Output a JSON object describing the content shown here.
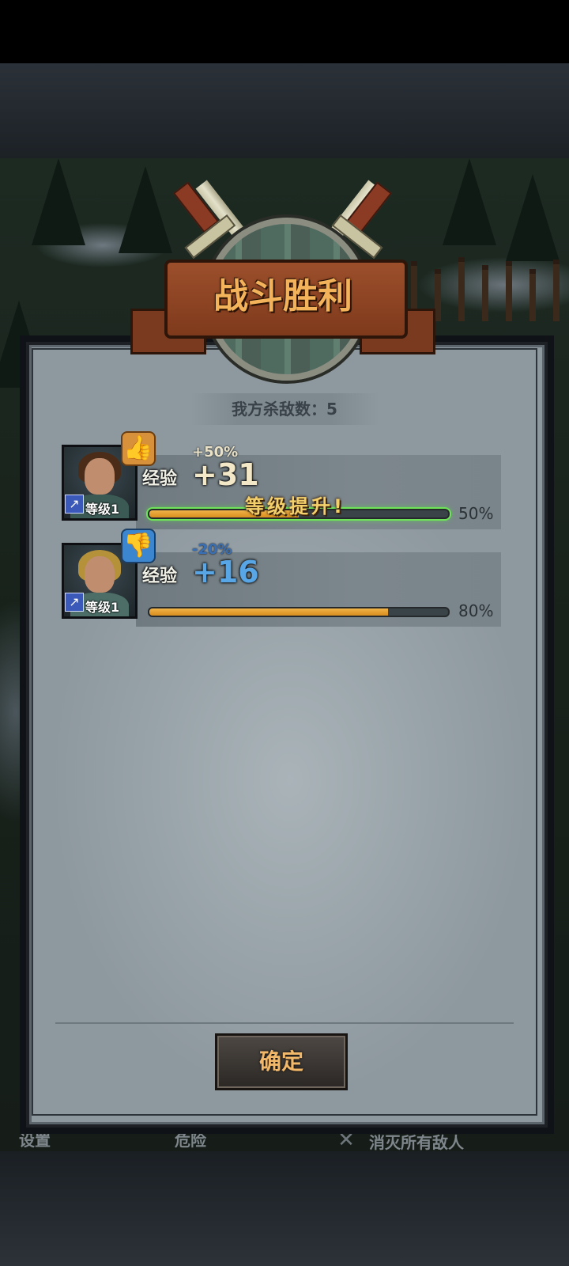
{
  "header": {
    "title": "战斗胜利"
  },
  "battle": {
    "kills_text": "我方杀敌数：5"
  },
  "heroes": [
    {
      "exp_label": "经验",
      "bonus": "+50%",
      "gain": "+31",
      "level_label": "等级1",
      "progress_pct_label": "50%",
      "progress": 0.5,
      "level_up_text": "等级提升!",
      "feedback_icon": "thumbs-up-icon"
    },
    {
      "exp_label": "经验",
      "bonus": "-20%",
      "gain": "+16",
      "level_label": "等级1",
      "progress_pct_label": "80%",
      "progress": 0.8,
      "feedback_icon": "thumbs-down-icon"
    }
  ],
  "actions": {
    "confirm_label": "确定"
  },
  "bottom_bar": {
    "settings_label": "设置",
    "danger_label": "危险",
    "objective_label": "消灭所有敌人"
  },
  "colors": {
    "bonus_positive": "#e9e2c8",
    "bonus_negative": "#3a6fb3",
    "gain_positive": "#f2e7c6",
    "gain_negative": "#58a6e6",
    "exp_fill": "#e09a2a",
    "level_up_glow": "#6fe35a"
  }
}
